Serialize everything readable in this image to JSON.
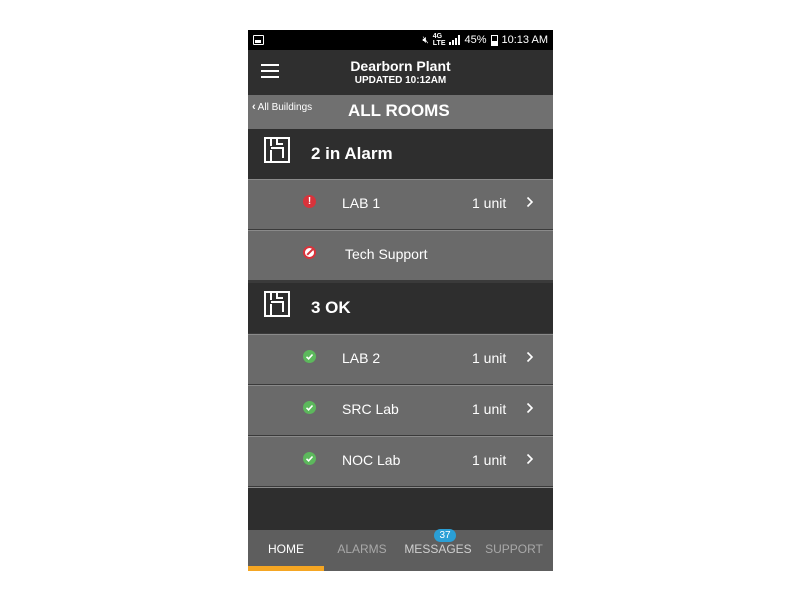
{
  "status_bar": {
    "battery": "45%",
    "time": "10:13 AM",
    "network": "4G",
    "network_sub": "LTE"
  },
  "app_bar": {
    "title": "Dearborn Plant",
    "subtitle": "UPDATED 10:12AM",
    "menu_icon": "hamburger-icon"
  },
  "breadcrumb": {
    "back_label": "All Buildings",
    "title": "ALL ROOMS"
  },
  "sections": [
    {
      "title": "2  in Alarm",
      "icon": "floorplan-icon",
      "rows": [
        {
          "name": "LAB 1",
          "units": "1 unit",
          "status": "alarm",
          "chevron": true
        },
        {
          "name": "Tech Support",
          "units": "",
          "status": "disabled",
          "chevron": false
        }
      ]
    },
    {
      "title": "3  OK",
      "icon": "floorplan-icon",
      "rows": [
        {
          "name": "LAB 2",
          "units": "1 unit",
          "status": "ok",
          "chevron": true
        },
        {
          "name": "SRC Lab",
          "units": "1 unit",
          "status": "ok",
          "chevron": true
        },
        {
          "name": "NOC Lab",
          "units": "1 unit",
          "status": "ok",
          "chevron": true
        }
      ]
    }
  ],
  "tabs": [
    {
      "label": "HOME",
      "active": true
    },
    {
      "label": "ALARMS",
      "active": false
    },
    {
      "label": "MESSAGES",
      "active": false,
      "badge": "37"
    },
    {
      "label": "SUPPORT",
      "active": false
    }
  ],
  "colors": {
    "accent": "#f5a623",
    "alarm": "#d8333b",
    "ok": "#5cb85c",
    "badge": "#2a9fd6"
  }
}
